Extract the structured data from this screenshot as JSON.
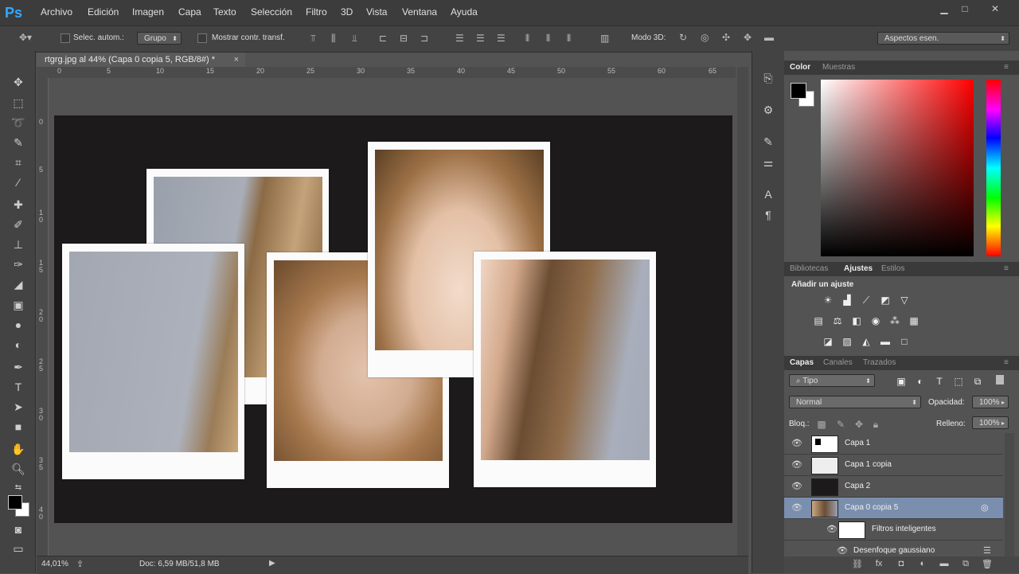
{
  "app": {
    "logo": "Ps"
  },
  "menu": [
    "Archivo",
    "Edición",
    "Imagen",
    "Capa",
    "Texto",
    "Selección",
    "Filtro",
    "3D",
    "Vista",
    "Ventana",
    "Ayuda"
  ],
  "window_controls": {
    "minimize": "▁",
    "maximize": "□",
    "close": "✕"
  },
  "options": {
    "auto_select_label": "Selec. autom.:",
    "auto_select_value": "Grupo",
    "transform_label": "Mostrar contr. transf.",
    "mode3d_label": "Modo 3D:",
    "workspace": "Aspectos esen."
  },
  "document": {
    "tab_title": "rtgrg.jpg al 44% (Capa 0 copia 5, RGB/8#) *",
    "close": "×",
    "zoom": "44,01%",
    "doc_info": "Doc: 6,59 MB/51,8 MB"
  },
  "ruler": {
    "top": [
      "0",
      "5",
      "10",
      "15",
      "20",
      "25",
      "30",
      "35",
      "40",
      "45",
      "50",
      "55",
      "60",
      "65"
    ],
    "left": [
      "0",
      "5",
      "1\n0",
      "1\n5",
      "2\n0",
      "2\n5",
      "3\n0",
      "3\n5",
      "4\n0"
    ]
  },
  "panels": {
    "color_tabs": [
      "Color",
      "Muestras"
    ],
    "adjust_tabs": [
      "Bibliotecas",
      "Ajustes",
      "Estilos"
    ],
    "adjust_title": "Añadir un ajuste",
    "layer_tabs": [
      "Capas",
      "Canales",
      "Trazados"
    ],
    "filter_kind": "Tipo",
    "blend_mode": "Normal",
    "opacity_label": "Opacidad:",
    "opacity_value": "100%",
    "lock_label": "Bloq.:",
    "fill_label": "Relleno:",
    "fill_value": "100%"
  },
  "layers": [
    {
      "name": "Capa 1"
    },
    {
      "name": "Capa 1 copia"
    },
    {
      "name": "Capa 2"
    },
    {
      "name": "Capa 0 copia 5",
      "selected": true
    },
    {
      "name": "Filtros inteligentes"
    },
    {
      "name": "Desenfoque gaussiano"
    }
  ],
  "colors": {
    "accent": "#31a8ff",
    "selected_layer": "#7a8fae"
  }
}
